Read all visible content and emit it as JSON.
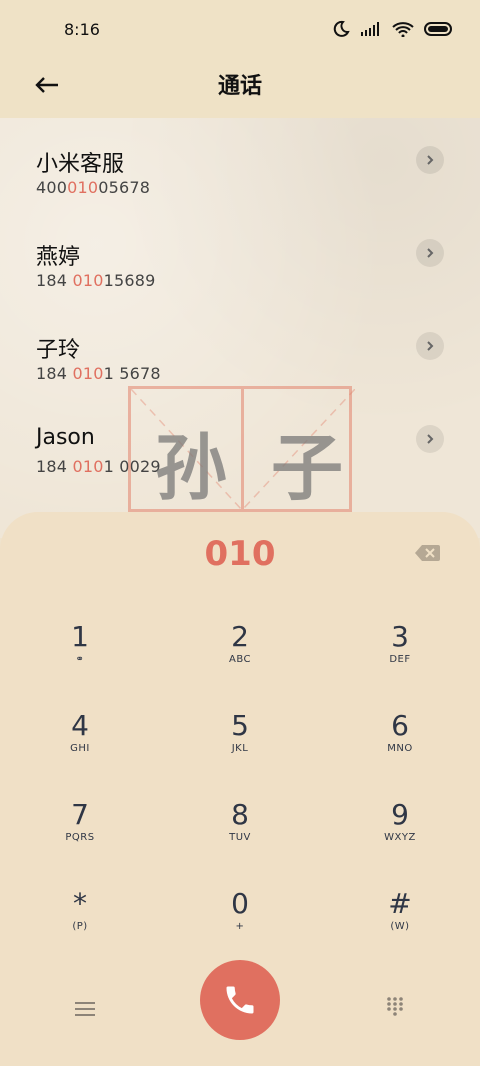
{
  "status": {
    "time": "8:16"
  },
  "header": {
    "title": "通话"
  },
  "contacts": [
    {
      "name": "小米客服",
      "num_pre": "400",
      "num_hl": "010",
      "num_post": "05678"
    },
    {
      "name": "燕婷",
      "num_pre": "184 ",
      "num_hl": "010",
      "num_post": "15689"
    },
    {
      "name": "子玲",
      "num_pre": "184 ",
      "num_hl": "010",
      "num_post": "1 5678"
    },
    {
      "name": "Jason",
      "num_pre": "184 ",
      "num_hl": "010",
      "num_post": "1 0029"
    }
  ],
  "seal": {
    "left": "孙",
    "right": "子"
  },
  "dialer": {
    "input": "010",
    "keys": [
      {
        "main": "1",
        "sub": "⚭"
      },
      {
        "main": "2",
        "sub": "ABC"
      },
      {
        "main": "3",
        "sub": "DEF"
      },
      {
        "main": "4",
        "sub": "GHI"
      },
      {
        "main": "5",
        "sub": "JKL"
      },
      {
        "main": "6",
        "sub": "MNO"
      },
      {
        "main": "7",
        "sub": "PQRS"
      },
      {
        "main": "8",
        "sub": "TUV"
      },
      {
        "main": "9",
        "sub": "WXYZ"
      },
      {
        "main": "*",
        "sub": "(P)"
      },
      {
        "main": "0",
        "sub": "+"
      },
      {
        "main": "#",
        "sub": "(W)"
      }
    ]
  },
  "colors": {
    "accent": "#e07060",
    "background": "#efe3cd"
  }
}
